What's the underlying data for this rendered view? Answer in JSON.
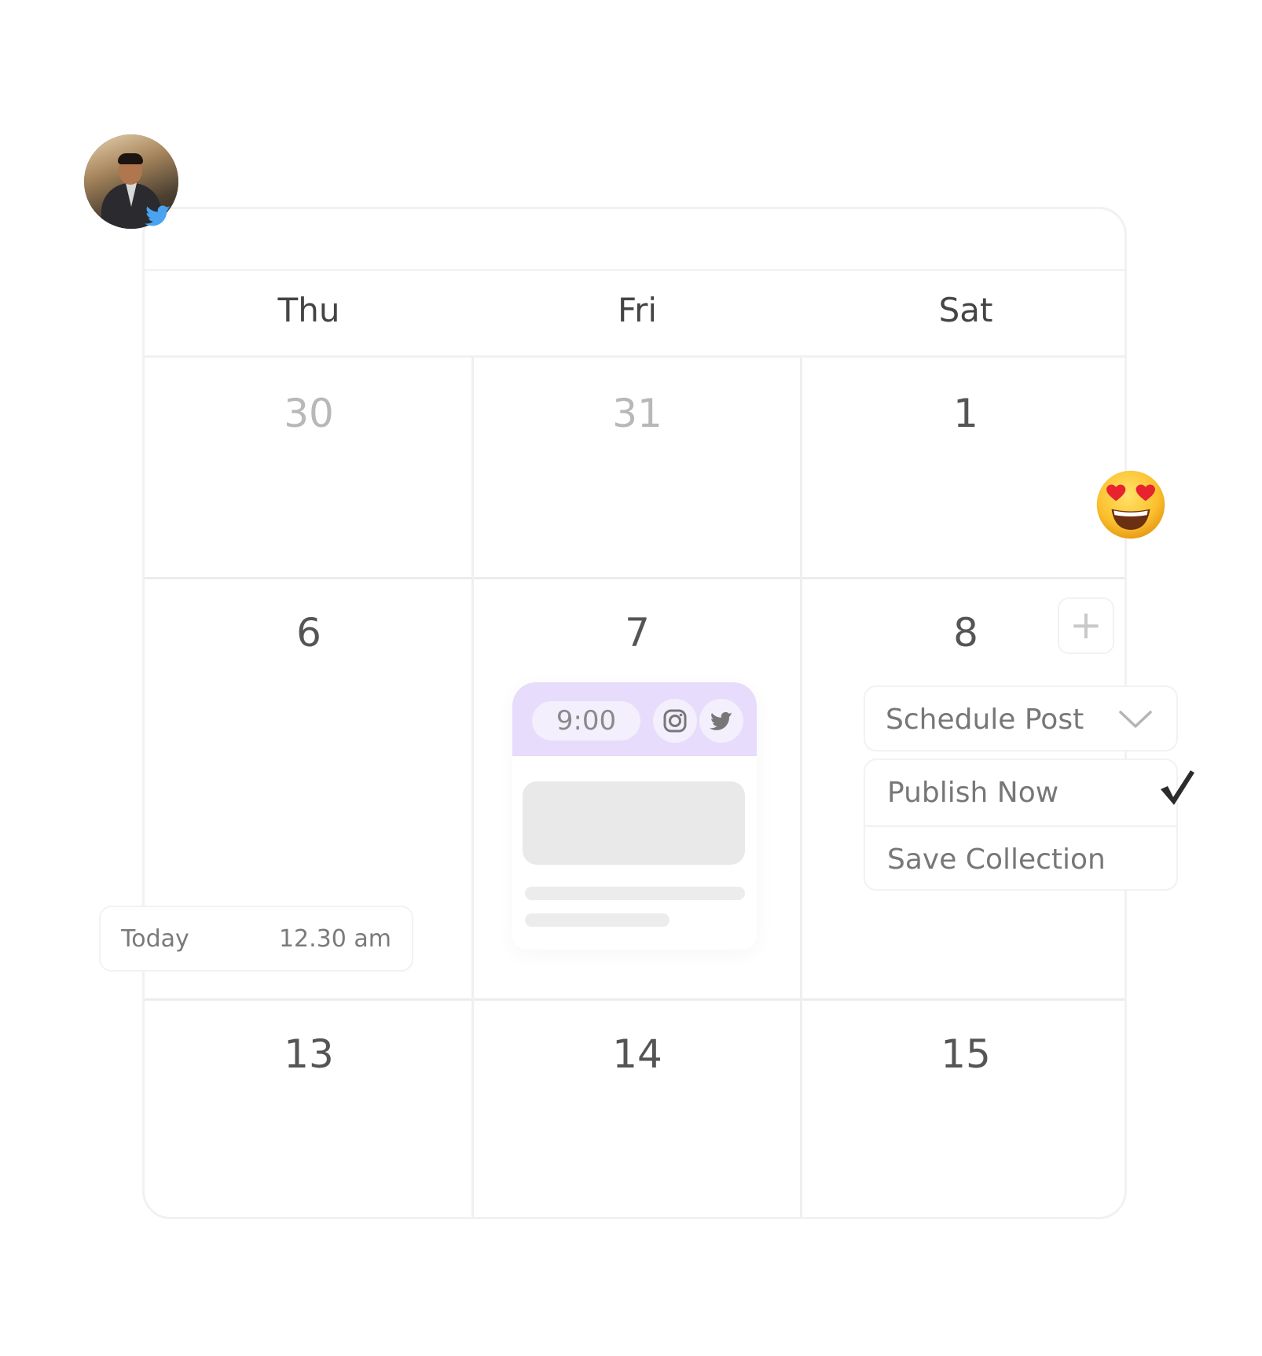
{
  "calendar": {
    "weekdays": [
      "Thu",
      "Fri",
      "Sat"
    ],
    "weeks": [
      [
        "30",
        "31",
        "1"
      ],
      [
        "6",
        "7",
        "8"
      ],
      [
        "13",
        "14",
        "15"
      ]
    ]
  },
  "post": {
    "time": "9:00",
    "platform_icons": [
      "instagram-icon",
      "twitter-icon"
    ],
    "header_color": "#e7dcfb"
  },
  "today": {
    "label": "Today",
    "time": "12.30 am"
  },
  "schedule": {
    "selected": "Schedule Post",
    "options": [
      "Publish Now",
      "Save Collection"
    ],
    "checked_option": "Publish Now"
  },
  "add_button": {
    "symbol": "+"
  },
  "avatar": {
    "badge": "twitter-icon",
    "badge_color": "#4aa3f0"
  },
  "emoji": {
    "name": "heart-eyes-emoji"
  }
}
